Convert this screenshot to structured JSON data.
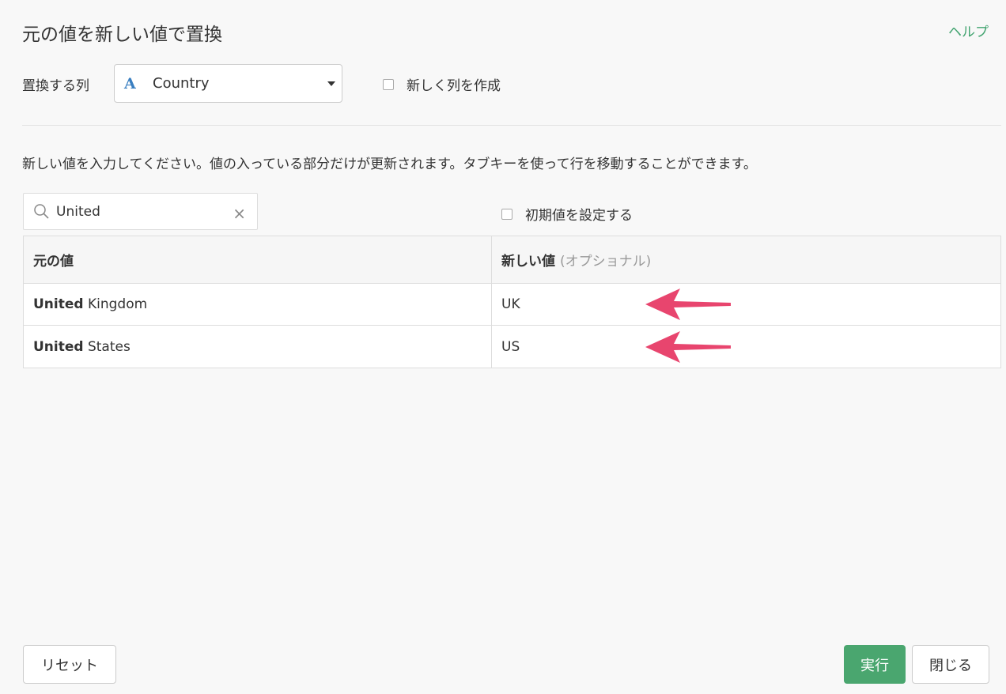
{
  "dialog": {
    "title": "元の値を新しい値で置換",
    "help_label": "ヘルプ"
  },
  "column_select": {
    "label": "置換する列",
    "type_icon": "A",
    "selected": "Country"
  },
  "new_column_checkbox": {
    "label": "新しく列を作成",
    "checked": false
  },
  "instruction": "新しい値を入力してください。値の入っている部分だけが更新されます。タブキーを使って行を移動することができます。",
  "search": {
    "value": "United",
    "icon": "search-icon"
  },
  "default_value_checkbox": {
    "label": "初期値を設定する",
    "checked": false
  },
  "table": {
    "headers": {
      "original": "元の値",
      "new": "新しい値",
      "new_optional": "(オプショナル)"
    },
    "rows": [
      {
        "match": "United",
        "rest": " Kingdom",
        "new_value": "UK"
      },
      {
        "match": "United",
        "rest": " States",
        "new_value": "US"
      }
    ]
  },
  "buttons": {
    "reset": "リセット",
    "run": "実行",
    "close": "閉じる"
  },
  "colors": {
    "accent": "#4aa66f",
    "annotation_arrow": "#e8456e",
    "type_icon": "#3a7fc1"
  }
}
